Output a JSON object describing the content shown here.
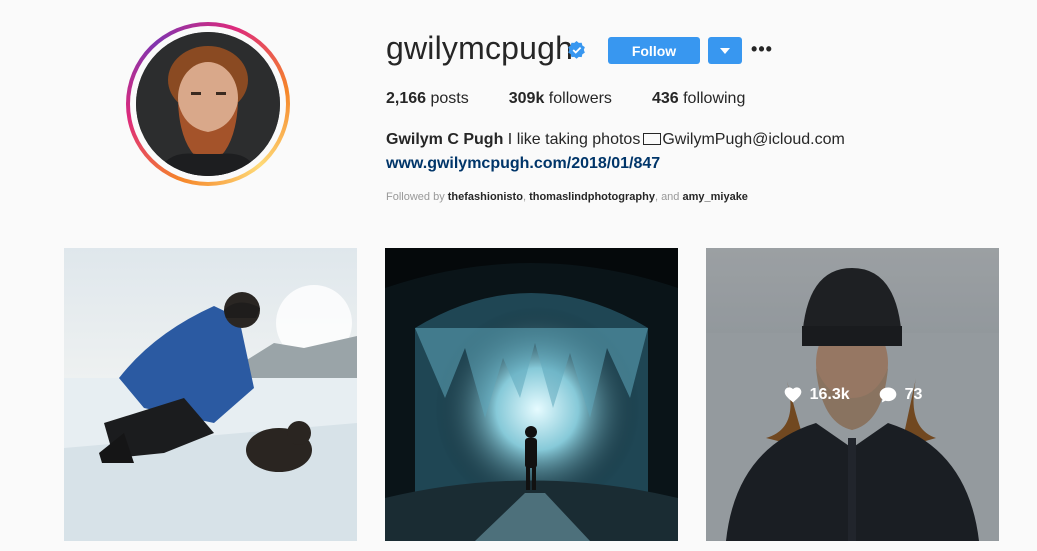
{
  "profile": {
    "username": "gwilymcpugh",
    "follow_label": "Follow",
    "more_label": "•••",
    "stats": {
      "posts_count": "2,166",
      "posts_label": "posts",
      "followers_count": "309k",
      "followers_label": "followers",
      "following_count": "436",
      "following_label": "following"
    },
    "full_name": "Gwilym C Pugh",
    "bio_text": "I like taking photos",
    "email": "GwilymPugh@icloud.com",
    "website": "www.gwilymcpugh.com/2018/01/847",
    "followed_by_prefix": "Followed by",
    "followed_by": [
      "thefashionisto",
      "thomaslindphotography",
      "amy_miyake"
    ],
    "followed_by_and": ", and"
  },
  "posts": [
    {
      "kind": "man-with-dog-on-ice"
    },
    {
      "kind": "ice-cave"
    },
    {
      "kind": "portrait-frozen-beard",
      "likes": "16.3k",
      "comments": "73",
      "hover": true
    }
  ],
  "colors": {
    "accent": "#3897f0",
    "link": "#003569",
    "muted": "#999999"
  },
  "icons": [
    "verified-badge-icon",
    "chevron-down-icon",
    "ellipsis-icon",
    "envelope-icon",
    "heart-icon",
    "comment-icon"
  ]
}
